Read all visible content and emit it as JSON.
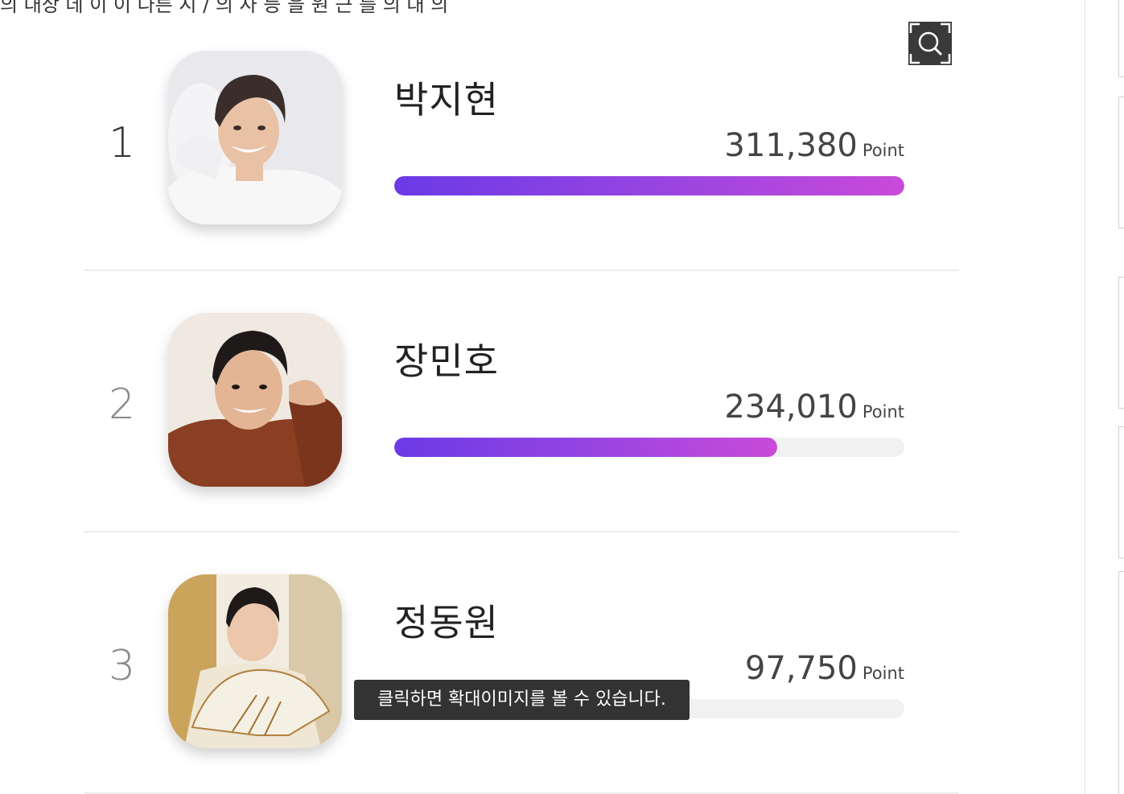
{
  "top_cut_text": "의 대상 데 이 이 다른 시 / 의 사 등 을 원 근 를 의 대 의",
  "zoom_button": {
    "icon": "zoom-search-icon",
    "label": "확대"
  },
  "ranking": [
    {
      "rank": "1",
      "name": "박지현",
      "points": "311,380",
      "unit": "Point",
      "progress": 1.0
    },
    {
      "rank": "2",
      "name": "장민호",
      "points": "234,010",
      "unit": "Point",
      "progress": 0.75
    },
    {
      "rank": "3",
      "name": "정동원",
      "points": "97,750",
      "unit": "Point",
      "progress": 0.31
    }
  ],
  "tooltip": {
    "text": "클릭하면 확대이미지를 볼 수 있습니다."
  },
  "colors": {
    "bar_start": "#6b3ae6",
    "bar_end": "#c94ad8",
    "track": "#f1f1f1",
    "tooltip_bg": "#333333"
  }
}
